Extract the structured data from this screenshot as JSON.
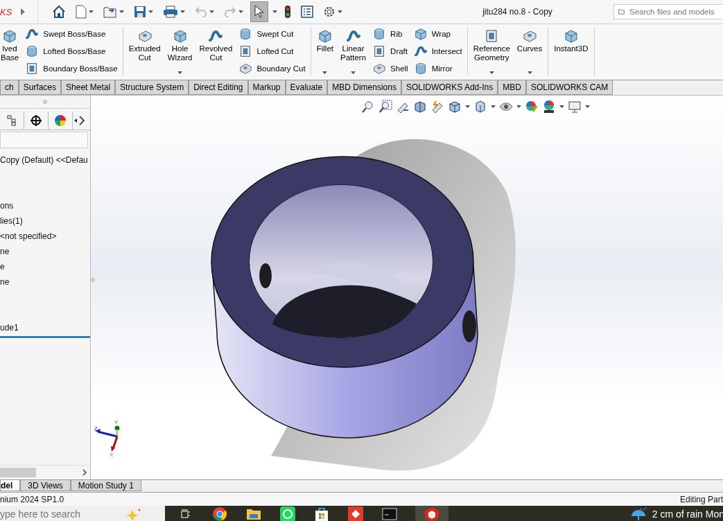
{
  "titlebar": {
    "logo": "KS",
    "select_pressed": true,
    "title": "jitu284 no.8 - Copy",
    "search": {
      "placeholder": "Search files and models"
    }
  },
  "ribbon": {
    "groups": [
      {
        "items": [
          {
            "kind": "large",
            "label": "lved Base",
            "dropdown": false
          },
          {
            "kind": "stack",
            "items": [
              {
                "label": "Swept Boss/Base"
              },
              {
                "label": "Lofted Boss/Base"
              },
              {
                "label": "Boundary Boss/Base"
              }
            ]
          }
        ]
      },
      {
        "items": [
          {
            "kind": "large",
            "label": "Extruded Cut",
            "dropdown": false
          },
          {
            "kind": "large",
            "label": "Hole Wizard",
            "dropdown": true
          },
          {
            "kind": "large",
            "label": "Revolved Cut",
            "dropdown": false
          },
          {
            "kind": "stack",
            "items": [
              {
                "label": "Swept Cut"
              },
              {
                "label": "Lofted Cut"
              },
              {
                "label": "Boundary Cut"
              }
            ]
          }
        ]
      },
      {
        "items": [
          {
            "kind": "large",
            "label": "Fillet",
            "dropdown": true
          },
          {
            "kind": "large",
            "label": "Linear Pattern",
            "dropdown": true
          },
          {
            "kind": "stack",
            "items": [
              {
                "label": "Rib"
              },
              {
                "label": "Draft"
              },
              {
                "label": "Shell"
              }
            ]
          },
          {
            "kind": "stack",
            "items": [
              {
                "label": "Wrap"
              },
              {
                "label": "Intersect"
              },
              {
                "label": "Mirror"
              }
            ]
          }
        ]
      },
      {
        "items": [
          {
            "kind": "large",
            "label": "Reference Geometry",
            "dropdown": true
          },
          {
            "kind": "large",
            "label": "Curves",
            "dropdown": true
          }
        ]
      },
      {
        "items": [
          {
            "kind": "large",
            "label": "Instant3D",
            "dropdown": false
          }
        ]
      }
    ]
  },
  "tabs": [
    {
      "label": "ch",
      "selected": false
    },
    {
      "label": "Surfaces",
      "selected": false
    },
    {
      "label": "Sheet Metal",
      "selected": false
    },
    {
      "label": "Structure System",
      "selected": false
    },
    {
      "label": "Direct Editing",
      "selected": false
    },
    {
      "label": "Markup",
      "selected": false
    },
    {
      "label": "Evaluate",
      "selected": false
    },
    {
      "label": "MBD Dimensions",
      "selected": false
    },
    {
      "label": "SOLIDWORKS Add-Ins",
      "selected": false
    },
    {
      "label": "MBD",
      "selected": false
    },
    {
      "label": "SOLIDWORKS CAM",
      "selected": false
    }
  ],
  "feature_tree": {
    "items": [
      {
        "label": "Copy (Default) <<Defau"
      },
      {
        "label": "ons"
      },
      {
        "label": "lies(1)"
      },
      {
        "label": "<not specified>"
      },
      {
        "label": "ne"
      },
      {
        "label": "e"
      },
      {
        "label": "ne"
      },
      {
        "label": "ude1"
      }
    ]
  },
  "triad": {
    "y": "Y",
    "z": "Z",
    "x": "X"
  },
  "bottom_tabs": [
    {
      "label": "del",
      "selected": true
    },
    {
      "label": "3D Views",
      "selected": false
    },
    {
      "label": "Motion Study 1",
      "selected": false
    }
  ],
  "status_bar": {
    "left": "nium 2024 SP1.0",
    "right": "Editing Part"
  },
  "taskbar": {
    "search": {
      "placeholder": "ype here to search"
    },
    "weather": "2 cm of rain Mon"
  }
}
